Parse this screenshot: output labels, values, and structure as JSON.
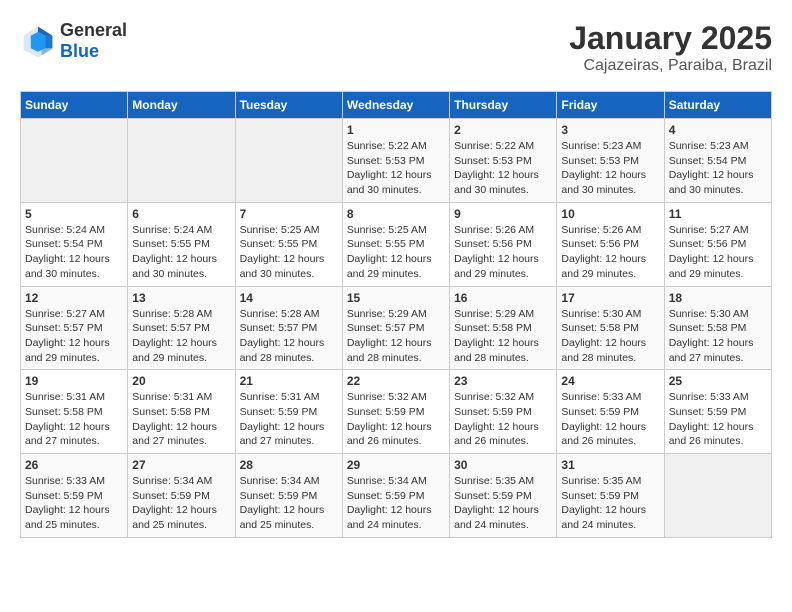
{
  "header": {
    "logo_general": "General",
    "logo_blue": "Blue",
    "title": "January 2025",
    "subtitle": "Cajazeiras, Paraiba, Brazil"
  },
  "calendar": {
    "days_of_week": [
      "Sunday",
      "Monday",
      "Tuesday",
      "Wednesday",
      "Thursday",
      "Friday",
      "Saturday"
    ],
    "weeks": [
      [
        {
          "day": "",
          "info": ""
        },
        {
          "day": "",
          "info": ""
        },
        {
          "day": "",
          "info": ""
        },
        {
          "day": "1",
          "info": "Sunrise: 5:22 AM\nSunset: 5:53 PM\nDaylight: 12 hours\nand 30 minutes."
        },
        {
          "day": "2",
          "info": "Sunrise: 5:22 AM\nSunset: 5:53 PM\nDaylight: 12 hours\nand 30 minutes."
        },
        {
          "day": "3",
          "info": "Sunrise: 5:23 AM\nSunset: 5:53 PM\nDaylight: 12 hours\nand 30 minutes."
        },
        {
          "day": "4",
          "info": "Sunrise: 5:23 AM\nSunset: 5:54 PM\nDaylight: 12 hours\nand 30 minutes."
        }
      ],
      [
        {
          "day": "5",
          "info": "Sunrise: 5:24 AM\nSunset: 5:54 PM\nDaylight: 12 hours\nand 30 minutes."
        },
        {
          "day": "6",
          "info": "Sunrise: 5:24 AM\nSunset: 5:55 PM\nDaylight: 12 hours\nand 30 minutes."
        },
        {
          "day": "7",
          "info": "Sunrise: 5:25 AM\nSunset: 5:55 PM\nDaylight: 12 hours\nand 30 minutes."
        },
        {
          "day": "8",
          "info": "Sunrise: 5:25 AM\nSunset: 5:55 PM\nDaylight: 12 hours\nand 29 minutes."
        },
        {
          "day": "9",
          "info": "Sunrise: 5:26 AM\nSunset: 5:56 PM\nDaylight: 12 hours\nand 29 minutes."
        },
        {
          "day": "10",
          "info": "Sunrise: 5:26 AM\nSunset: 5:56 PM\nDaylight: 12 hours\nand 29 minutes."
        },
        {
          "day": "11",
          "info": "Sunrise: 5:27 AM\nSunset: 5:56 PM\nDaylight: 12 hours\nand 29 minutes."
        }
      ],
      [
        {
          "day": "12",
          "info": "Sunrise: 5:27 AM\nSunset: 5:57 PM\nDaylight: 12 hours\nand 29 minutes."
        },
        {
          "day": "13",
          "info": "Sunrise: 5:28 AM\nSunset: 5:57 PM\nDaylight: 12 hours\nand 29 minutes."
        },
        {
          "day": "14",
          "info": "Sunrise: 5:28 AM\nSunset: 5:57 PM\nDaylight: 12 hours\nand 28 minutes."
        },
        {
          "day": "15",
          "info": "Sunrise: 5:29 AM\nSunset: 5:57 PM\nDaylight: 12 hours\nand 28 minutes."
        },
        {
          "day": "16",
          "info": "Sunrise: 5:29 AM\nSunset: 5:58 PM\nDaylight: 12 hours\nand 28 minutes."
        },
        {
          "day": "17",
          "info": "Sunrise: 5:30 AM\nSunset: 5:58 PM\nDaylight: 12 hours\nand 28 minutes."
        },
        {
          "day": "18",
          "info": "Sunrise: 5:30 AM\nSunset: 5:58 PM\nDaylight: 12 hours\nand 27 minutes."
        }
      ],
      [
        {
          "day": "19",
          "info": "Sunrise: 5:31 AM\nSunset: 5:58 PM\nDaylight: 12 hours\nand 27 minutes."
        },
        {
          "day": "20",
          "info": "Sunrise: 5:31 AM\nSunset: 5:58 PM\nDaylight: 12 hours\nand 27 minutes."
        },
        {
          "day": "21",
          "info": "Sunrise: 5:31 AM\nSunset: 5:59 PM\nDaylight: 12 hours\nand 27 minutes."
        },
        {
          "day": "22",
          "info": "Sunrise: 5:32 AM\nSunset: 5:59 PM\nDaylight: 12 hours\nand 26 minutes."
        },
        {
          "day": "23",
          "info": "Sunrise: 5:32 AM\nSunset: 5:59 PM\nDaylight: 12 hours\nand 26 minutes."
        },
        {
          "day": "24",
          "info": "Sunrise: 5:33 AM\nSunset: 5:59 PM\nDaylight: 12 hours\nand 26 minutes."
        },
        {
          "day": "25",
          "info": "Sunrise: 5:33 AM\nSunset: 5:59 PM\nDaylight: 12 hours\nand 26 minutes."
        }
      ],
      [
        {
          "day": "26",
          "info": "Sunrise: 5:33 AM\nSunset: 5:59 PM\nDaylight: 12 hours\nand 25 minutes."
        },
        {
          "day": "27",
          "info": "Sunrise: 5:34 AM\nSunset: 5:59 PM\nDaylight: 12 hours\nand 25 minutes."
        },
        {
          "day": "28",
          "info": "Sunrise: 5:34 AM\nSunset: 5:59 PM\nDaylight: 12 hours\nand 25 minutes."
        },
        {
          "day": "29",
          "info": "Sunrise: 5:34 AM\nSunset: 5:59 PM\nDaylight: 12 hours\nand 24 minutes."
        },
        {
          "day": "30",
          "info": "Sunrise: 5:35 AM\nSunset: 5:59 PM\nDaylight: 12 hours\nand 24 minutes."
        },
        {
          "day": "31",
          "info": "Sunrise: 5:35 AM\nSunset: 5:59 PM\nDaylight: 12 hours\nand 24 minutes."
        },
        {
          "day": "",
          "info": ""
        }
      ]
    ]
  }
}
